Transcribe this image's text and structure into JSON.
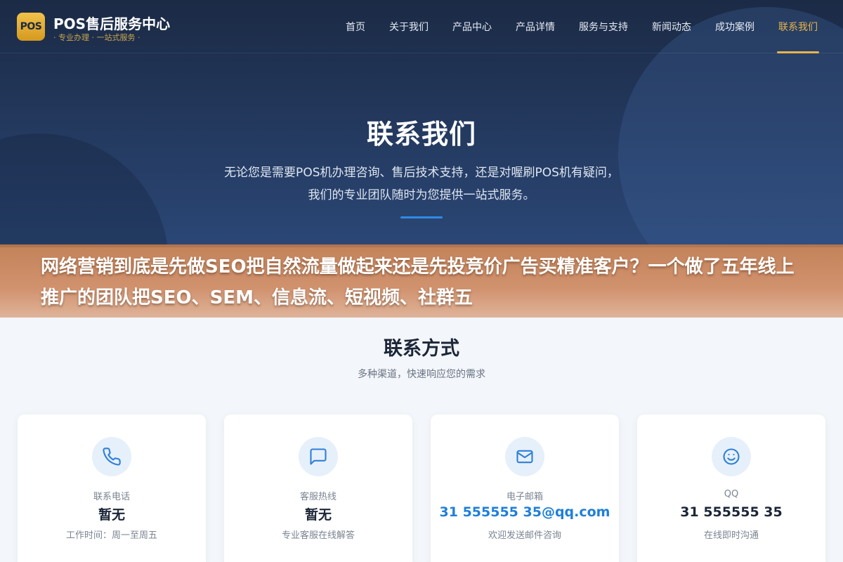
{
  "header": {
    "logo_text": "POS",
    "brand_name": "POS售后服务中心",
    "slogan": "· 专业办理 · 一站式服务 ·",
    "nav": [
      {
        "label": "首页"
      },
      {
        "label": "关于我们"
      },
      {
        "label": "产品中心"
      },
      {
        "label": "产品详情"
      },
      {
        "label": "服务与支持"
      },
      {
        "label": "新闻动态"
      },
      {
        "label": "成功案例"
      },
      {
        "label": "联系我们",
        "active": true
      }
    ]
  },
  "hero": {
    "title": "联系我们",
    "desc_line1": "无论您是需要POS机办理咨询、售后技术支持，还是对喔刷POS机有疑问，",
    "desc_line2": "我们的专业团队随时为您提供一站式服务。"
  },
  "banner": {
    "text": "网络营销到底是先做SEO把自然流量做起来还是先投竞价广告买精准客户？一个做了五年线上推广的团队把SEO、SEM、信息流、短视频、社群五"
  },
  "contact": {
    "title": "联系方式",
    "subtitle": "多种渠道，快速响应您的需求",
    "cards": [
      {
        "icon": "phone-icon",
        "label": "联系电话",
        "value": "暂无",
        "note": "工作时间：周一至周五"
      },
      {
        "icon": "chat-icon",
        "label": "客服热线",
        "value": "暂无",
        "note": "专业客服在线解答"
      },
      {
        "icon": "mail-icon",
        "label": "电子邮箱",
        "value": "31 555555 35@qq.com",
        "note": "欢迎发送邮件咨询"
      },
      {
        "icon": "smile-icon",
        "label": "QQ",
        "value": "31 555555 35",
        "note": "在线即时沟通"
      }
    ]
  },
  "colors": {
    "accent_gold": "#e8b44a",
    "accent_blue": "#1f7fd8",
    "hero_bg": "#243a60"
  }
}
